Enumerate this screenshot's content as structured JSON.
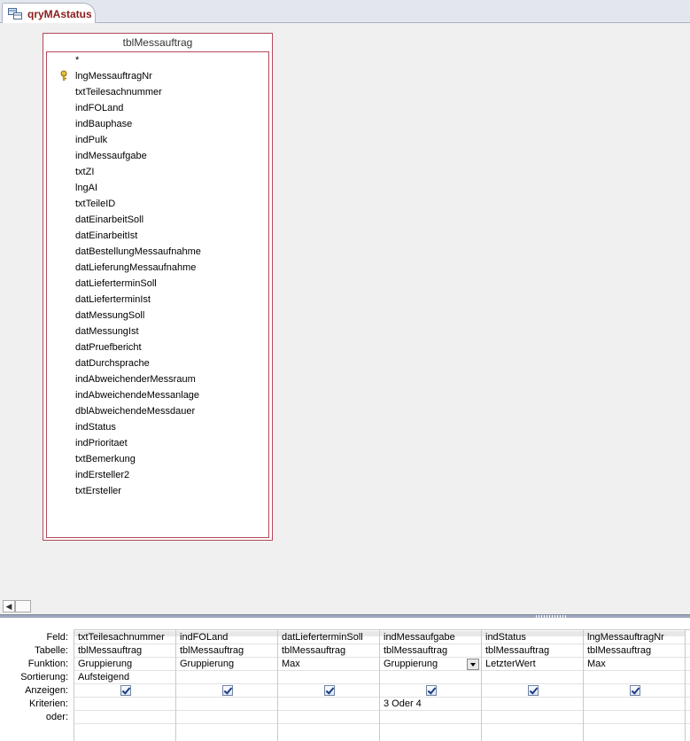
{
  "tab": {
    "title": "qryMAstatus"
  },
  "table": {
    "title": "tblMessauftrag",
    "fields": [
      "*",
      "lngMessauftragNr",
      "txtTeilesachnummer",
      "indFOLand",
      "indBauphase",
      "indPulk",
      "indMessaufgabe",
      "txtZI",
      "lngAI",
      "txtTeileID",
      "datEinarbeitSoll",
      "datEinarbeitIst",
      "datBestellungMessaufnahme",
      "datLieferungMessaufnahme",
      "datLieferterminSoll",
      "datLieferterminIst",
      "datMessungSoll",
      "datMessungIst",
      "datPruefbericht",
      "datDurchsprache",
      "indAbweichenderMessraum",
      "indAbweichendeMessanlage",
      "dblAbweichendeMessdauer",
      "indStatus",
      "indPrioritaet",
      "txtBemerkung",
      "indErsteller2",
      "txtErsteller"
    ],
    "primary_key_field": "lngMessauftragNr"
  },
  "grid": {
    "row_labels": [
      "Feld:",
      "Tabelle:",
      "Funktion:",
      "Sortierung:",
      "Anzeigen:",
      "Kriterien:",
      "oder:"
    ],
    "columns": [
      {
        "feld": "txtTeilesachnummer",
        "tabelle": "tblMessauftrag",
        "funktion": "Gruppierung",
        "sortierung": "Aufsteigend",
        "anzeigen": true,
        "kriterien": ""
      },
      {
        "feld": "indFOLand",
        "tabelle": "tblMessauftrag",
        "funktion": "Gruppierung",
        "sortierung": "",
        "anzeigen": true,
        "kriterien": ""
      },
      {
        "feld": "datLieferterminSoll",
        "tabelle": "tblMessauftrag",
        "funktion": "Max",
        "sortierung": "",
        "anzeigen": true,
        "kriterien": ""
      },
      {
        "feld": "indMessaufgabe",
        "tabelle": "tblMessauftrag",
        "funktion": "Gruppierung",
        "sortierung": "",
        "anzeigen": true,
        "kriterien": "3 Oder 4"
      },
      {
        "feld": "indStatus",
        "tabelle": "tblMessauftrag",
        "funktion": "LetzterWert",
        "sortierung": "",
        "anzeigen": true,
        "kriterien": ""
      },
      {
        "feld": "lngMessauftragNr",
        "tabelle": "tblMessauftrag",
        "funktion": "Max",
        "sortierung": "",
        "anzeigen": true,
        "kriterien": ""
      }
    ]
  },
  "colors": {
    "accent": "#8b1a1a",
    "table_border": "#b2495c"
  }
}
